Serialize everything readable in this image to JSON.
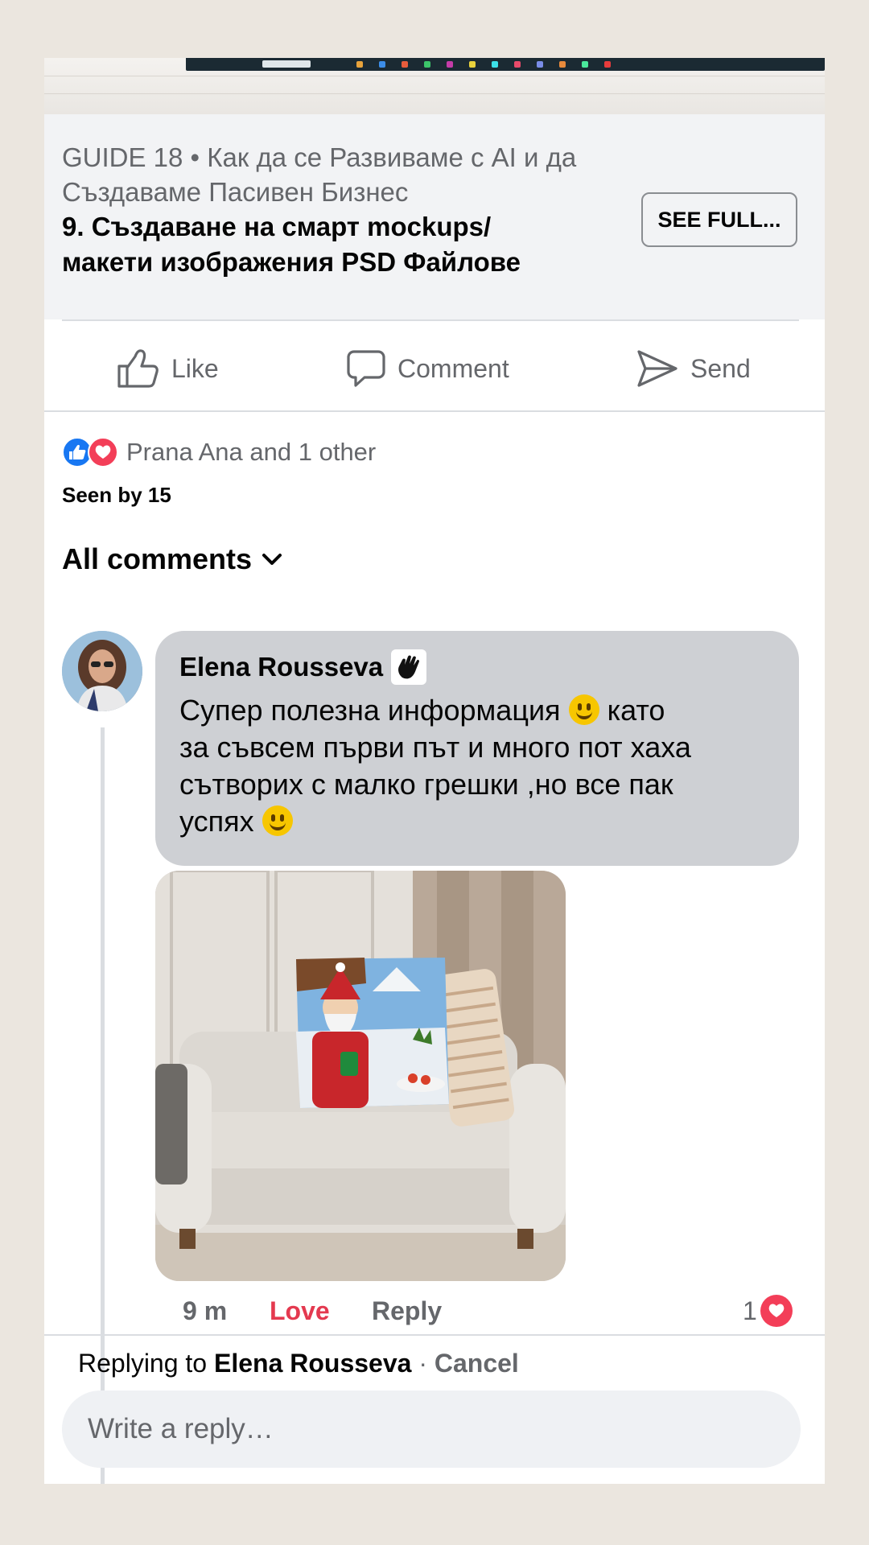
{
  "post": {
    "link_title_gray": "GUIDE 18 • Как да се Развиваме с AI и да Създаваме  Пасивен Бизнес",
    "link_title_bold": "9. Създаване на смарт mockups/ макети изображения PSD Файлове",
    "see_full_label": "SEE FULL..."
  },
  "actions": {
    "like_label": "Like",
    "comment_label": "Comment",
    "send_label": "Send"
  },
  "reactions": {
    "text": "Prana Ana and 1 other",
    "seen": "Seen by 15"
  },
  "comments_filter": {
    "label": "All comments"
  },
  "comment": {
    "author": "Elena Rousseva",
    "text_line1": "Супер полезна информация ",
    "text_line1_end": " като\nза съвсем първи път и много пот хаха\nсътворих с малко грешки ,но все пак\nуспях ",
    "time": "9 m",
    "love_label": "Love",
    "reply_label": "Reply",
    "reaction_count": "1"
  },
  "reply": {
    "prefix": "Replying to ",
    "name": "Elena Rousseva",
    "sep": " · ",
    "cancel": "Cancel",
    "placeholder": "Write a reply…"
  },
  "colors": {
    "accent_like": "#1877f2",
    "accent_love": "#f33e58",
    "text_secondary": "#65676b"
  }
}
